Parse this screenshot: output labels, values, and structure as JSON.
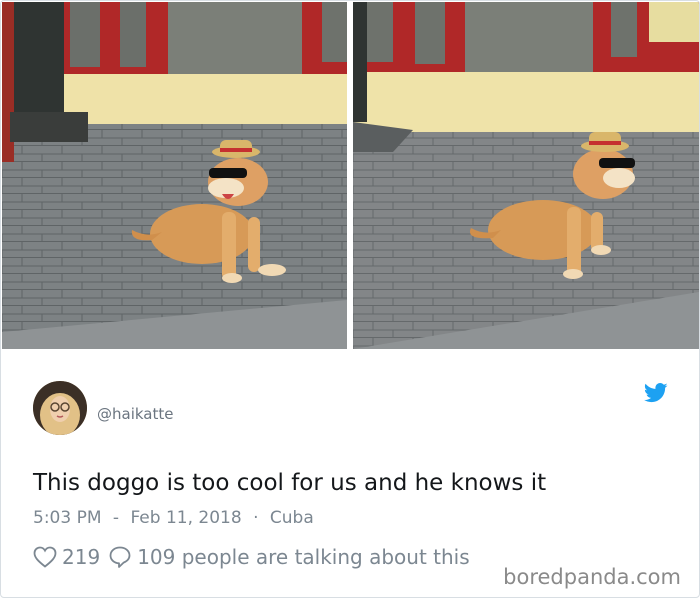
{
  "tweet": {
    "handle": "@haikatte",
    "text": "This doggo is too cool for us and he knows it",
    "time": "5:03 PM",
    "date": "Feb 11, 2018",
    "location": "Cuba",
    "likes": "219",
    "replies": "109 people are talking about this",
    "meta_sep1": "-",
    "meta_sep2": "·"
  },
  "icons": {
    "twitter": "twitter-bird-icon",
    "like": "heart-icon",
    "reply": "speech-bubble-icon"
  },
  "colors": {
    "twitter_blue": "#1da1f2",
    "text": "#14171a",
    "muted": "#7c8791"
  },
  "watermark": "boredpanda.com"
}
